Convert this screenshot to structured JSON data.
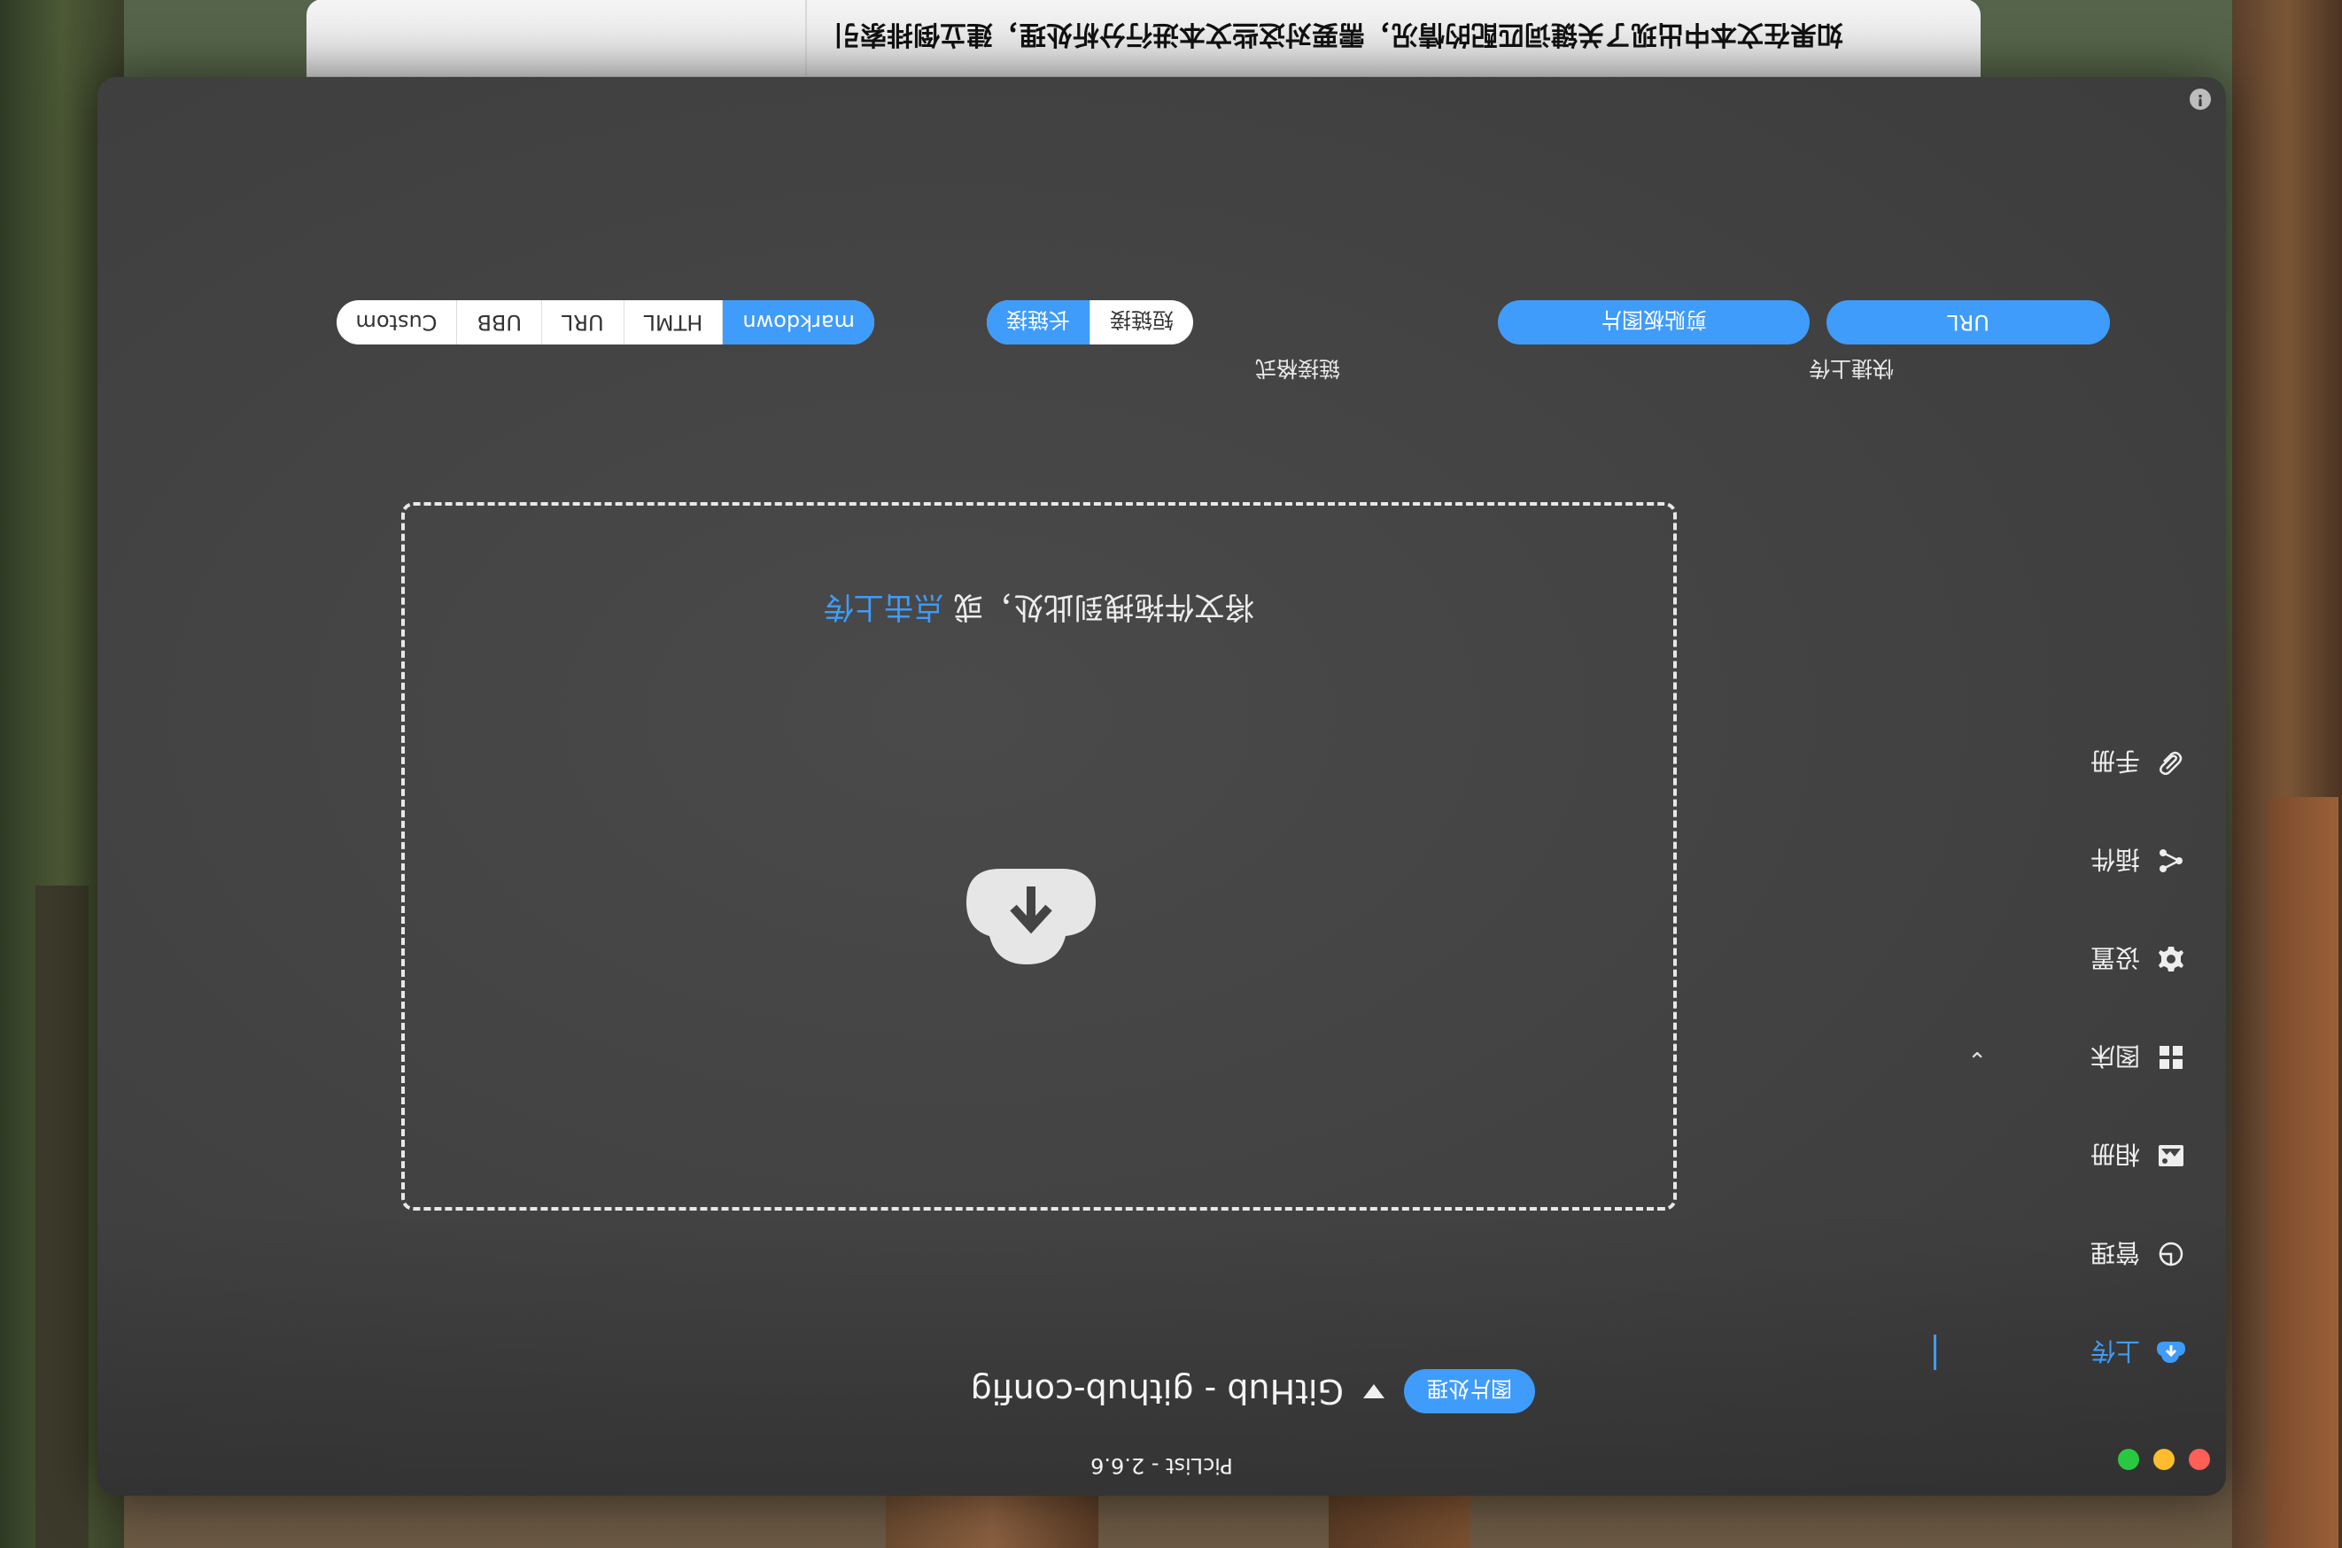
{
  "editor": {
    "text": "如果在文本中出现了关键词匹配的情况，需要对这些文本进行分析处理，建立倒排索引"
  },
  "window": {
    "title": "PicList - 2.6.6",
    "colors": {
      "accent": "#3f9cfa",
      "close": "#ff5f57",
      "minimize": "#febc2e",
      "zoom": "#28c840"
    }
  },
  "sidebar": {
    "items": [
      {
        "label": "上传",
        "icon": "upload-cloud-icon",
        "active": true
      },
      {
        "label": "管理",
        "icon": "pie-chart-icon"
      },
      {
        "label": "相册",
        "icon": "picture-icon"
      },
      {
        "label": "图床",
        "icon": "grid-icon",
        "expanded": true
      },
      {
        "label": "设置",
        "icon": "gear-icon"
      },
      {
        "label": "插件",
        "icon": "share-icon"
      },
      {
        "label": "手册",
        "icon": "paperclip-icon"
      }
    ]
  },
  "upload": {
    "picbed_name": "GitHub - github-config",
    "process_button": "图片处理",
    "drop_text": "将文件拖拽到此处，或",
    "click_text": "点击上传"
  },
  "link_format": {
    "label": "链接格式",
    "options": [
      "markdown",
      "HTML",
      "URL",
      "UBB",
      "Custom"
    ],
    "selected": "markdown",
    "length_options": [
      "短链接",
      "长链接"
    ],
    "length_selected": "长链接"
  },
  "quick_upload": {
    "label": "快捷上传",
    "clipboard_button": "剪贴板图片",
    "url_button": "URL"
  }
}
